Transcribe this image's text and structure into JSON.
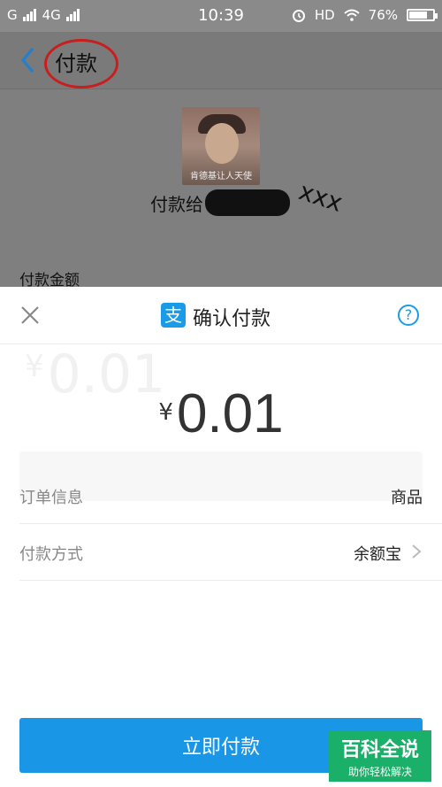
{
  "status_bar": {
    "carrier1": "G",
    "carrier2": "4G",
    "time": "10:39",
    "hd": "HD",
    "battery": "76%",
    "battery_level": 0.76
  },
  "header": {
    "title": "付款"
  },
  "payee": {
    "avatar_caption": "肯德基让人天使",
    "pay_to_prefix": "付款给",
    "annotation": "xxx"
  },
  "background": {
    "amount_label": "付款金额",
    "ghost_amount": "0.01"
  },
  "sheet": {
    "logo": "支",
    "title": "确认付款",
    "help": "?",
    "currency": "¥",
    "amount": "0.01",
    "rows": [
      {
        "label": "订单信息",
        "value": "商品"
      },
      {
        "label": "付款方式",
        "value": "余额宝"
      }
    ],
    "pay_button": "立即付款"
  },
  "watermark": {
    "title": "百科全说",
    "subtitle": "助你轻松解决"
  },
  "colors": {
    "accent": "#1a96e6",
    "watermark": "#1bb06a",
    "circle": "#c81e1e"
  }
}
